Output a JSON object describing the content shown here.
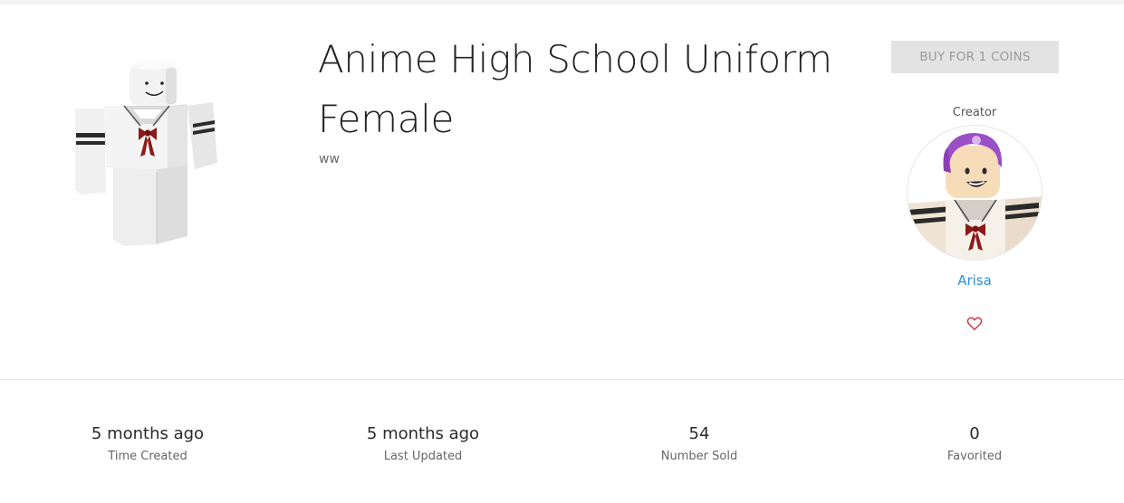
{
  "item": {
    "title": "Anime High School Uniform Female",
    "description": "ww"
  },
  "purchase": {
    "buy_label": "BUY FOR 1 COINS"
  },
  "creator": {
    "label": "Creator",
    "name": "Arisa"
  },
  "icons": {
    "favorite": "heart-outline-icon"
  },
  "stats": [
    {
      "value": "5 months ago",
      "label": "Time Created"
    },
    {
      "value": "5 months ago",
      "label": "Last Updated"
    },
    {
      "value": "54",
      "label": "Number Sold"
    },
    {
      "value": "0",
      "label": "Favorited"
    }
  ],
  "colors": {
    "link": "#2f8fd8",
    "button_bg": "#e3e3e3",
    "button_text": "#9a9a9a",
    "heart": "#d0393f"
  }
}
